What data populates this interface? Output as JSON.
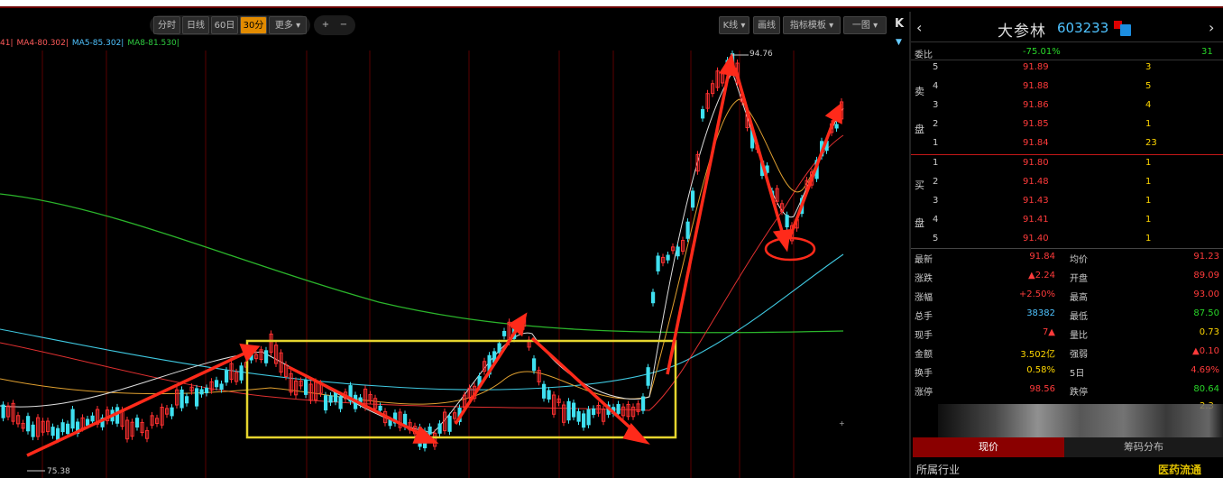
{
  "toolbar": {
    "period_buttons": [
      "分时",
      "日线",
      "60日",
      "30分",
      "更多 ▾"
    ],
    "active_period": "30分",
    "zoom_in": "+",
    "zoom_out": "−",
    "right_buttons": [
      "K线 ▾",
      "画线",
      "指标模板 ▾",
      "一图 ▾"
    ],
    "collapse": "K"
  },
  "ma_legend": [
    {
      "label": "41|",
      "color": "#ff5a5a"
    },
    {
      "label": "MA4-80.302|",
      "color": "#ff5a5a"
    },
    {
      "label": "MA5-85.302|",
      "color": "#4fc3ff"
    },
    {
      "label": "MA8-81.530|",
      "color": "#2ecc40"
    }
  ],
  "chart_labels": {
    "high": "94.76",
    "low": "75.38"
  },
  "chart_data": {
    "type": "candlestick",
    "high_price": 94.76,
    "low_price": 75.38,
    "annotations": [
      "yellow consolidation box",
      "red trend arrows",
      "red circle at pullback low"
    ]
  },
  "stock": {
    "name": "大参林",
    "code": "603233"
  },
  "ratio": {
    "label": "委比",
    "value": "-75.01%",
    "diff": "31"
  },
  "sell_side_label": [
    "卖",
    "盘"
  ],
  "buy_side_label": [
    "买",
    "盘"
  ],
  "sell_orders": [
    {
      "level": "5",
      "price": "91.89",
      "volume": "3"
    },
    {
      "level": "4",
      "price": "91.88",
      "volume": "5"
    },
    {
      "level": "3",
      "price": "91.86",
      "volume": "4"
    },
    {
      "level": "2",
      "price": "91.85",
      "volume": "1"
    },
    {
      "level": "1",
      "price": "91.84",
      "volume": "23"
    }
  ],
  "buy_orders": [
    {
      "level": "1",
      "price": "91.80",
      "volume": "1"
    },
    {
      "level": "2",
      "price": "91.48",
      "volume": "1"
    },
    {
      "level": "3",
      "price": "91.43",
      "volume": "1"
    },
    {
      "level": "4",
      "price": "91.41",
      "volume": "1"
    },
    {
      "level": "5",
      "price": "91.40",
      "volume": "1"
    }
  ],
  "stats": [
    {
      "l": "最新",
      "lv": "91.84",
      "lc": "red",
      "r": "均价",
      "rv": "91.23",
      "rc": "red"
    },
    {
      "l": "涨跌",
      "lv": "▲2.24",
      "lc": "red",
      "r": "开盘",
      "rv": "89.09",
      "rc": "red"
    },
    {
      "l": "涨幅",
      "lv": "+2.50%",
      "lc": "red",
      "r": "最高",
      "rv": "93.00",
      "rc": "red"
    },
    {
      "l": "总手",
      "lv": "38382",
      "lc": "blu",
      "r": "最低",
      "rv": "87.50",
      "rc": "grn"
    },
    {
      "l": "现手",
      "lv": "7▲",
      "lc": "red",
      "r": "量比",
      "rv": "0.73",
      "rc": "yel"
    },
    {
      "l": "金额",
      "lv": "3.502亿",
      "lc": "yel",
      "r": "强弱",
      "rv": "▲0.10",
      "rc": "red"
    },
    {
      "l": "换手",
      "lv": "0.58%",
      "lc": "yel",
      "r": "5日",
      "rv": "4.69%",
      "rc": "red"
    },
    {
      "l": "涨停",
      "lv": "98.56",
      "lc": "red",
      "r": "跌停",
      "rv": "80.64",
      "rc": "grn"
    }
  ],
  "extra_value": "2.3",
  "tabs": [
    "现价",
    "筹码分布"
  ],
  "industry": {
    "label": "所属行业",
    "value": "医药流通"
  }
}
